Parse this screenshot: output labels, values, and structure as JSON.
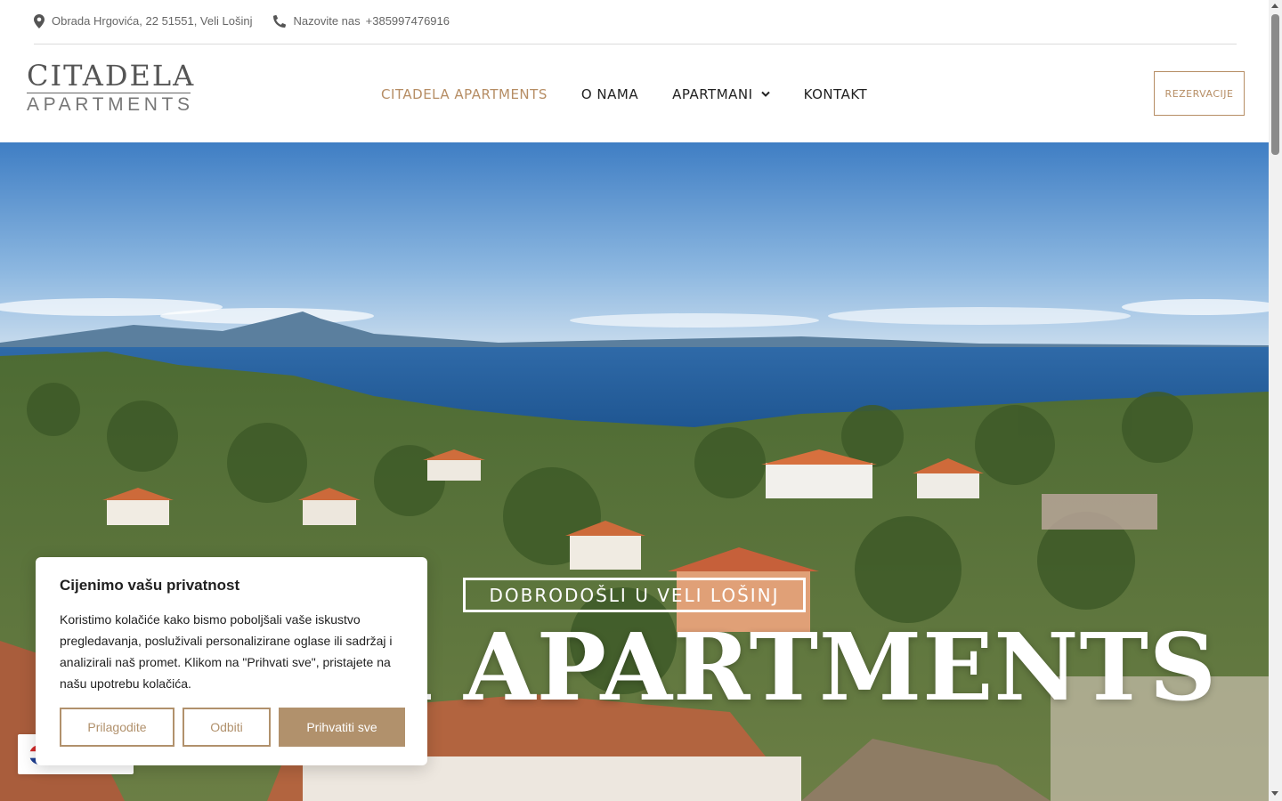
{
  "topbar": {
    "address": "Obrada Hrgovića, 22 51551, Veli Lošinj",
    "phone_label": "Nazovite nas",
    "phone_number": "+385997476916"
  },
  "logo": {
    "main": "CITADELA",
    "sub": "APARTMENTS"
  },
  "nav": {
    "items": [
      {
        "label": "CITADELA APARTMENTS",
        "active": true
      },
      {
        "label": "O NAMA"
      },
      {
        "label": "APARTMANI",
        "has_dropdown": true
      },
      {
        "label": "KONTAKT"
      }
    ],
    "reserve_label": "REZERVACIJE"
  },
  "hero": {
    "welcome": "DOBRODOŠLI U VELI LOŠINJ",
    "title_visible": "LA APARTMENTS"
  },
  "cookie": {
    "title": "Cijenimo vašu privatnost",
    "text": "Koristimo kolačiće kako bismo poboljšali vaše iskustvo pregledavanja, posluživali personalizirane oglase ili sadržaj i analizirali naš promet. Klikom na \"Prihvati sve\", pristajete na našu upotrebu kolačića.",
    "customize_label": "Prilagodite",
    "reject_label": "Odbiti",
    "accept_label": "Prihvatiti sve"
  },
  "colors": {
    "accent": "#b68d64",
    "cookie_accent": "#b1916c",
    "text_dark": "#222222"
  },
  "icons": {
    "address": "map-pin-icon",
    "phone": "phone-icon",
    "dropdown": "chevron-down-icon",
    "language": "flag-icon"
  }
}
